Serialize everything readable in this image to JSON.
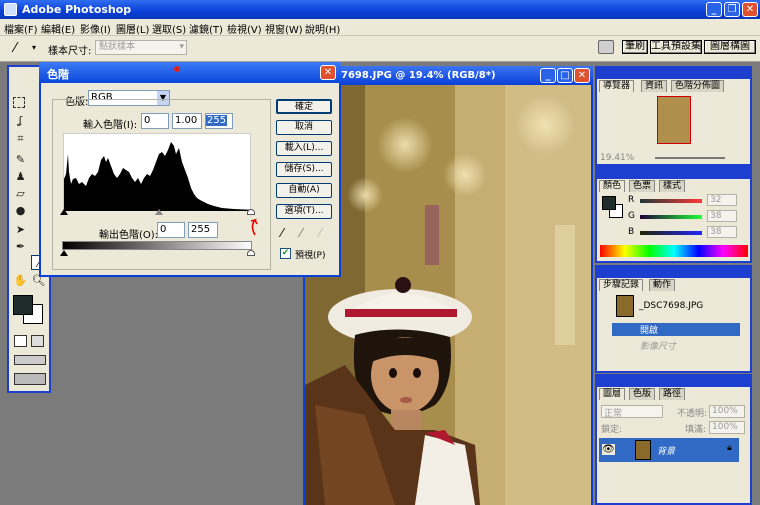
{
  "app": {
    "title": "Adobe Photoshop"
  },
  "menu": [
    "檔案(F)",
    "編輯(E)",
    "影像(I)",
    "圖層(L)",
    "選取(S)",
    "濾鏡(T)",
    "檢視(V)",
    "視窗(W)",
    "說明(H)"
  ],
  "options": {
    "sample_size_label": "樣本尺寸:",
    "sample_size_value": "點狀樣本",
    "tabs": [
      "筆刷",
      "工具預設集",
      "圖層構圖"
    ]
  },
  "document": {
    "title": "7698.JPG @ 19.4% (RGB/8*)"
  },
  "navigator": {
    "tabs": [
      "導覽器",
      "資訊",
      "色階分佈圖"
    ],
    "zoom": "19.41%"
  },
  "color": {
    "tabs": [
      "顏色",
      "色票",
      "樣式"
    ],
    "channels": [
      {
        "label": "R",
        "value": "32"
      },
      {
        "label": "G",
        "value": "38"
      },
      {
        "label": "B",
        "value": "38"
      }
    ]
  },
  "history": {
    "tabs": [
      "步驟記錄",
      "動作"
    ],
    "snapshot": "_DSC7698.JPG",
    "items": [
      "開啟",
      "影像尺寸"
    ]
  },
  "layers": {
    "tabs": [
      "圖層",
      "色版",
      "路徑"
    ],
    "blend_mode": "正常",
    "opacity_label": "不透明:",
    "opacity_value": "100%",
    "lock_label": "鎖定:",
    "fill_label": "填滿:",
    "fill_value": "100%",
    "layer_name": "背景"
  },
  "levels": {
    "title": "色階",
    "channel_label": "色版:",
    "channel_value": "RGB",
    "input_label": "輸入色階(I):",
    "input_values": [
      "0",
      "1.00",
      "255"
    ],
    "output_label": "輸出色階(O):",
    "output_values": [
      "0",
      "255"
    ],
    "buttons": [
      "確定",
      "取消",
      "載入(L)...",
      "儲存(S)...",
      "自動(A)",
      "選項(T)..."
    ],
    "preview_label": "預視(P)",
    "preview_checked": true
  }
}
